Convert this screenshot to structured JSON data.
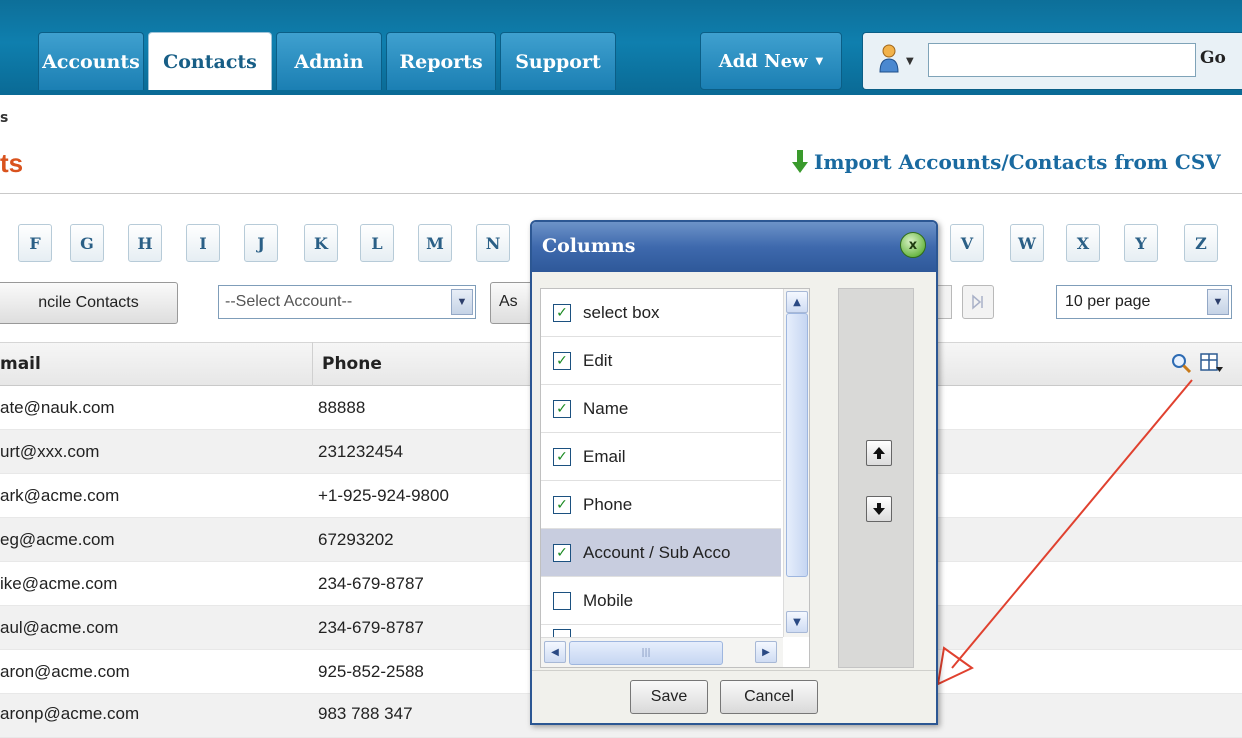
{
  "nav": {
    "tabs": [
      {
        "label": "Accounts"
      },
      {
        "label": "Contacts"
      },
      {
        "label": "Admin"
      },
      {
        "label": "Reports"
      },
      {
        "label": "Support"
      }
    ],
    "add_new": "Add New",
    "go": "Go",
    "search_value": ""
  },
  "header": {
    "crumb": "s",
    "title": "ts",
    "import_link": "Import Accounts/Contacts from CSV"
  },
  "alphabet": [
    "F",
    "G",
    "H",
    "I",
    "J",
    "K",
    "L",
    "M",
    "N",
    "V",
    "W",
    "X",
    "Y",
    "Z"
  ],
  "toolbar": {
    "reconcile": "ncile Contacts",
    "account_select": "--Select Account--",
    "assign_partial": "As",
    "per_page": "10 per page"
  },
  "table": {
    "headers": {
      "email": "mail",
      "phone": "Phone"
    },
    "rows": [
      {
        "email": "ate@nauk.com",
        "phone": "88888"
      },
      {
        "email": "urt@xxx.com",
        "phone": "231232454"
      },
      {
        "email": "ark@acme.com",
        "phone": "+1-925-924-9800"
      },
      {
        "email": "eg@acme.com",
        "phone": "67293202"
      },
      {
        "email": "ike@acme.com",
        "phone": "234-679-8787"
      },
      {
        "email": "aul@acme.com",
        "phone": "234-679-8787"
      },
      {
        "email": "aron@acme.com",
        "phone": "925-852-2588"
      },
      {
        "email": "aronp@acme.com",
        "phone": "983 788 347"
      }
    ]
  },
  "dialog": {
    "title": "Columns",
    "close": "x",
    "columns": [
      {
        "label": "select box",
        "checked": true
      },
      {
        "label": "Edit",
        "checked": true
      },
      {
        "label": "Name",
        "checked": true
      },
      {
        "label": "Email",
        "checked": true
      },
      {
        "label": "Phone",
        "checked": true
      },
      {
        "label": "Account / Sub Acco",
        "checked": true
      },
      {
        "label": "Mobile",
        "checked": false
      }
    ],
    "save": "Save",
    "cancel": "Cancel"
  },
  "colors": {
    "nav_bg": "#0f7fae",
    "title_orange": "#d9531e",
    "link_blue": "#1a6aa0",
    "dialog_title": "#3e69ad",
    "annotation_arrow": "#e0412f"
  },
  "icons": [
    "user-icon",
    "import-arrow-icon",
    "search-icon",
    "column-chooser-icon",
    "last-page-icon",
    "move-up-icon",
    "move-down-icon",
    "close-icon"
  ]
}
